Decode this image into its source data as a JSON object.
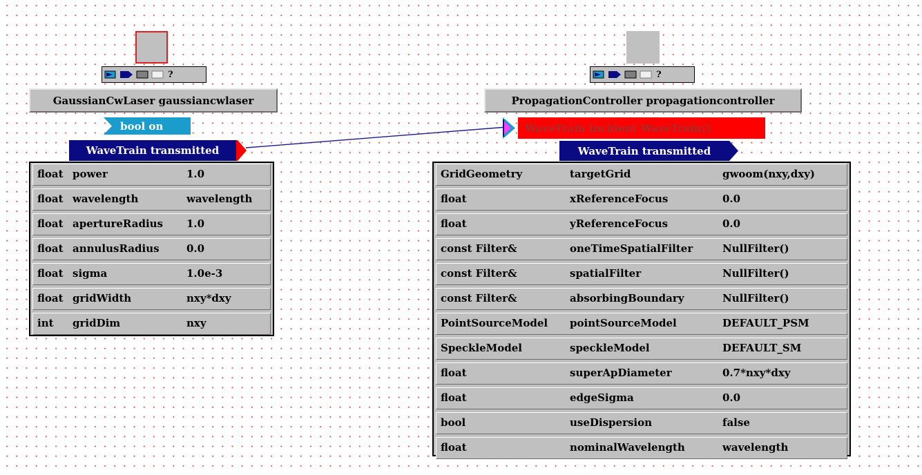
{
  "gaussian": {
    "title": "GaussianCwLaser gaussiancwlaser",
    "input_port": "bool on",
    "output_port": "WaveTrain transmitted",
    "toolbar": {
      "help_label": "?"
    },
    "params": [
      {
        "type": "float",
        "name": "power",
        "value": "1.0"
      },
      {
        "type": "float",
        "name": "wavelength",
        "value": "wavelength"
      },
      {
        "type": "float",
        "name": "apertureRadius",
        "value": "1.0"
      },
      {
        "type": "float",
        "name": "annulusRadius",
        "value": "0.0"
      },
      {
        "type": "float",
        "name": "sigma",
        "value": "1.0e-3"
      },
      {
        "type": "float",
        "name": "gridWidth",
        "value": "nxy*dxy"
      },
      {
        "type": "int",
        "name": "gridDim",
        "value": "nxy"
      }
    ]
  },
  "propagation": {
    "title": "PropagationController propagationcontroller",
    "input_port": "WaveTrain incident WaveTrain()",
    "output_port": "WaveTrain transmitted",
    "toolbar": {
      "help_label": "?"
    },
    "params": [
      {
        "type": "GridGeometry",
        "name": "targetGrid",
        "value": "gwoom(nxy,dxy)"
      },
      {
        "type": "float",
        "name": "xReferenceFocus",
        "value": "0.0"
      },
      {
        "type": "float",
        "name": "yReferenceFocus",
        "value": "0.0"
      },
      {
        "type": "const Filter&",
        "name": "oneTimeSpatialFilter",
        "value": "NullFilter()"
      },
      {
        "type": "const Filter&",
        "name": "spatialFilter",
        "value": "NullFilter()"
      },
      {
        "type": "const Filter&",
        "name": "absorbingBoundary",
        "value": "NullFilter()"
      },
      {
        "type": "PointSourceModel",
        "name": "pointSourceModel",
        "value": "DEFAULT_PSM"
      },
      {
        "type": "SpeckleModel",
        "name": "speckleModel",
        "value": "DEFAULT_SM"
      },
      {
        "type": "float",
        "name": "superApDiameter",
        "value": "0.7*nxy*dxy"
      },
      {
        "type": "float",
        "name": "edgeSigma",
        "value": "0.0"
      },
      {
        "type": "bool",
        "name": "useDispersion",
        "value": "false"
      },
      {
        "type": "float",
        "name": "nominalWavelength",
        "value": "wavelength"
      }
    ]
  },
  "colors": {
    "canvas_dot": "#e05050",
    "panel_gray": "#c0c0c0",
    "port_blue": "#0a0a82",
    "port_cyan": "#1a9ccc",
    "port_red": "#ff0000",
    "selected_outline": "#e02020",
    "connection": "#1a1a8c"
  },
  "icons": [
    "input-port-icon",
    "output-port-icon",
    "gray-box-icon",
    "white-box-icon"
  ]
}
